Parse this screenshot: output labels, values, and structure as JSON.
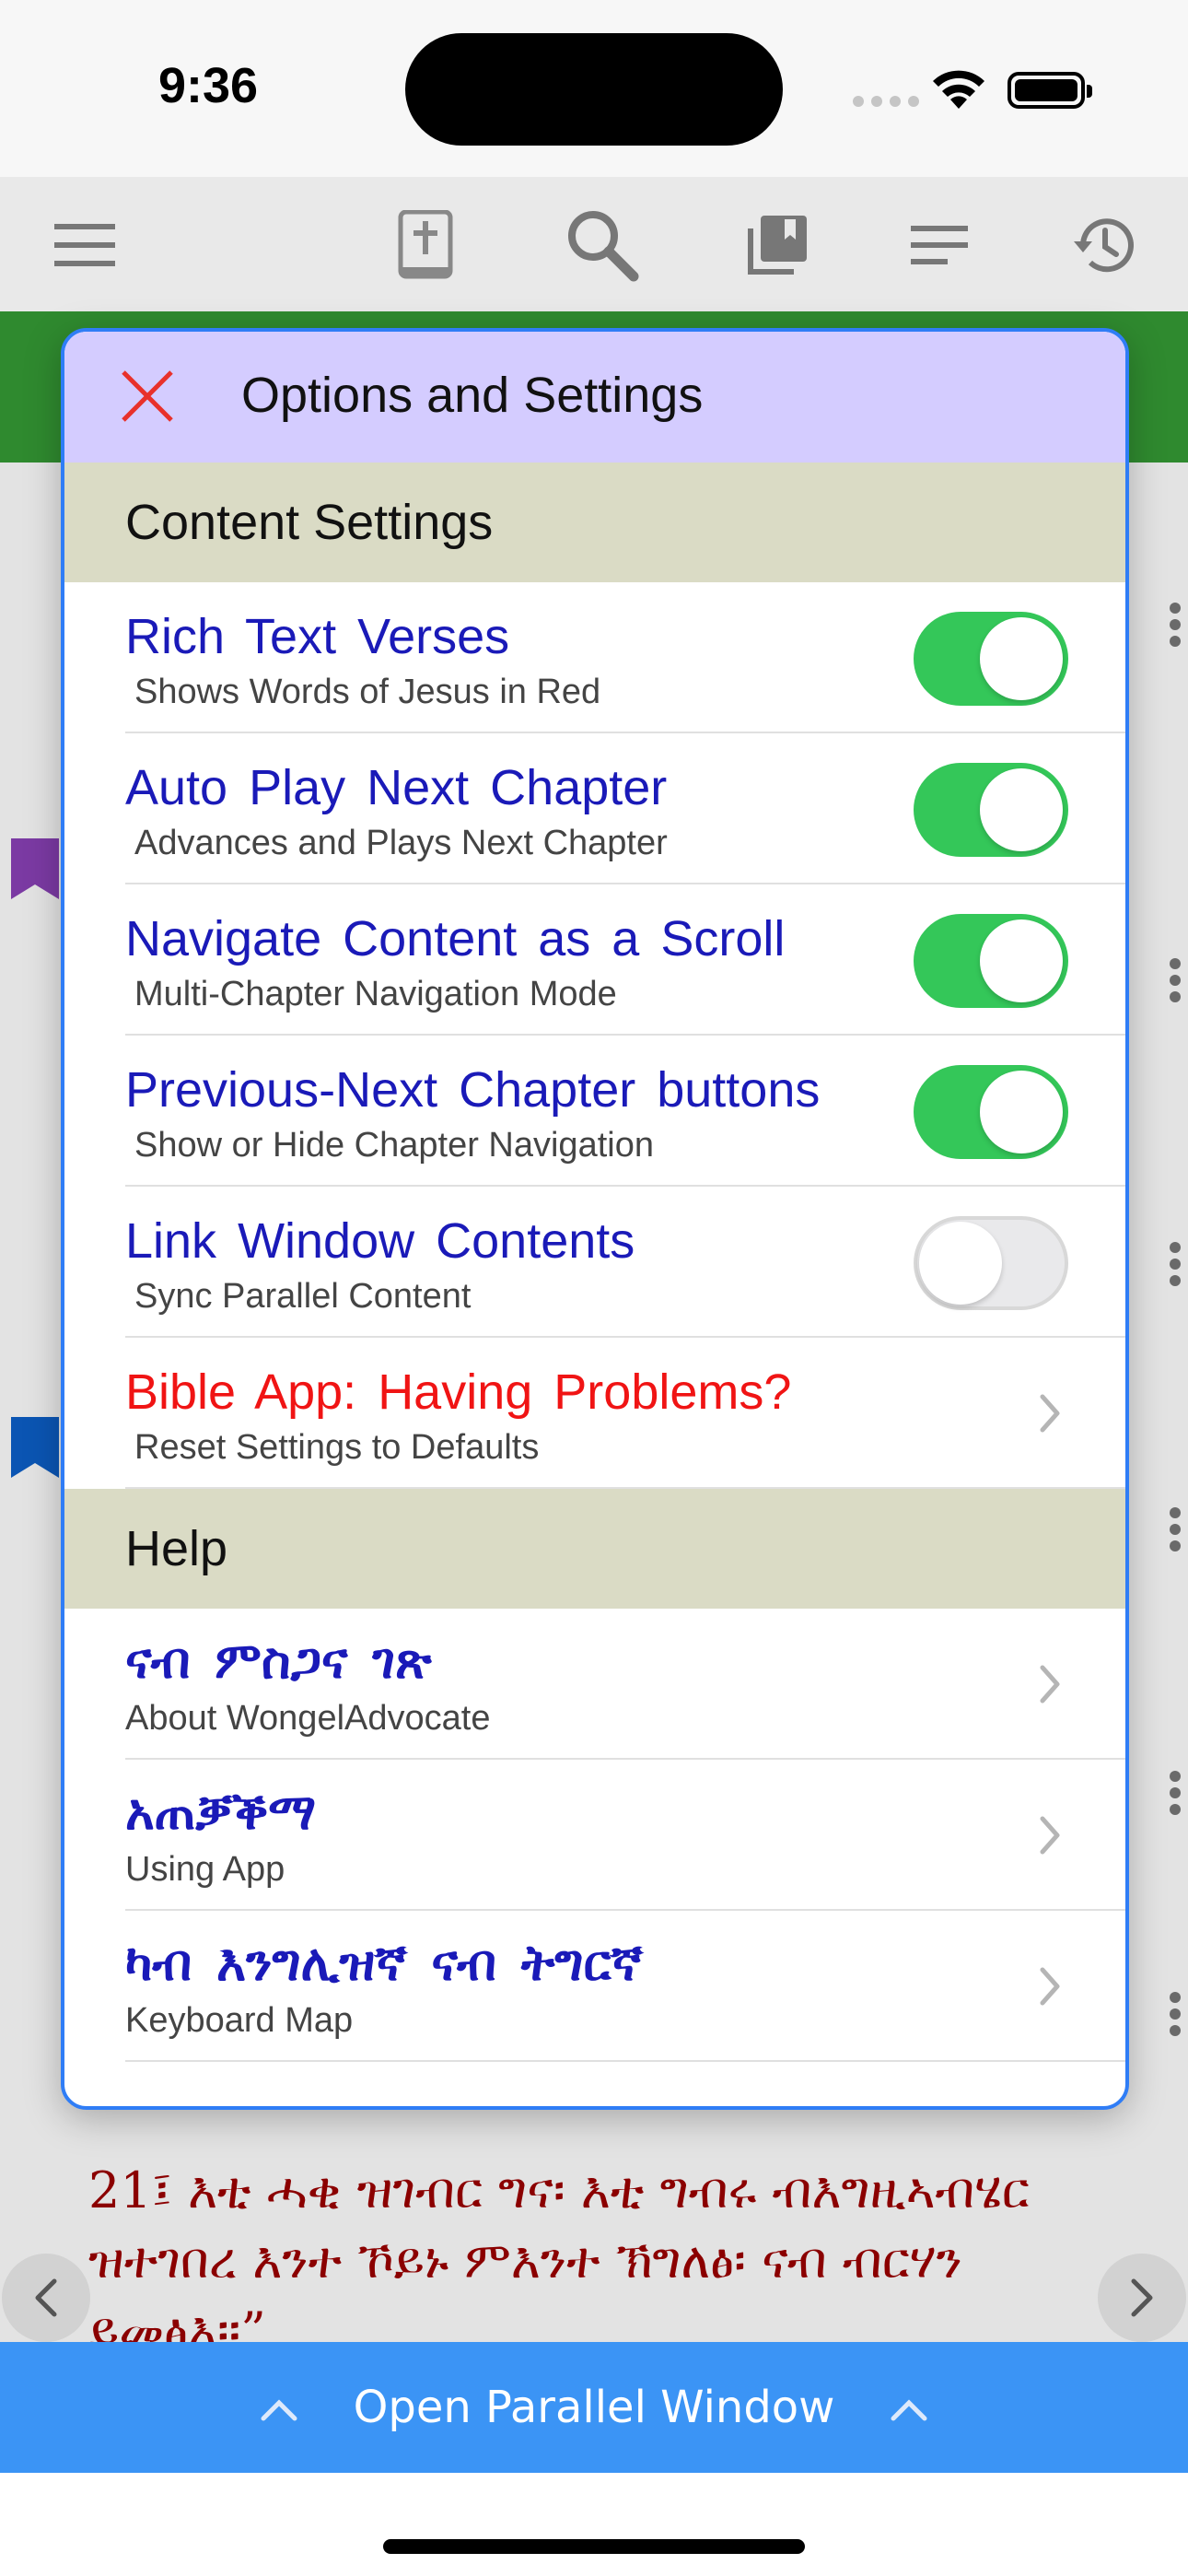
{
  "status_bar": {
    "time": "9:36"
  },
  "toolbar": {
    "icons": [
      "menu-icon",
      "bible-book-icon",
      "search-icon",
      "library-icon",
      "text-lines-icon",
      "history-icon"
    ]
  },
  "dialog": {
    "title": "Options and Settings",
    "content_section": "Content Settings",
    "settings": [
      {
        "title": "Rich Text Verses",
        "subtitle": "Shows Words of Jesus in Red",
        "on": true
      },
      {
        "title": "Auto Play Next Chapter",
        "subtitle": "Advances and Plays Next Chapter",
        "on": true
      },
      {
        "title": "Navigate Content as a Scroll",
        "subtitle": "Multi-Chapter Navigation Mode",
        "on": true
      },
      {
        "title": "Previous-Next Chapter buttons",
        "subtitle": "Show or Hide Chapter Navigation",
        "on": true
      },
      {
        "title": "Link Window Contents",
        "subtitle": "Sync Parallel Content",
        "on": false
      }
    ],
    "problems": {
      "title": "Bible App: Having Problems?",
      "subtitle": "Reset Settings to Defaults"
    },
    "help_section": "Help",
    "help_items": [
      {
        "title": "ናብ ምስጋና ገጽ",
        "subtitle": "About WongelAdvocate"
      },
      {
        "title": "አጠቓቕማ",
        "subtitle": "Using App"
      },
      {
        "title": "ካብ እንግሊዝኛ ናብ ትግርኛ",
        "subtitle": "Keyboard Map"
      }
    ]
  },
  "verse": {
    "text": "21፤ እቲ ሓቂ ዝገብር ግና፡ እቲ ግብሩ ብእግዚኣብሄር ዝተገበረ እንተ ኾይኑ ምእንተ ኽግለፅ፡ ናብ ብርሃን ይመፅእ።”"
  },
  "parallel_bar": {
    "label": "Open Parallel Window"
  },
  "colors": {
    "accent_blue": "#3b94f5",
    "toggle_on": "#34c759",
    "dialog_header": "#d4ccff",
    "section_bg": "#dadbc5",
    "setting_title": "#1a1ab8",
    "warning_title": "#f01414",
    "verse_text": "#8b0000",
    "green_band": "#2f8a2f"
  }
}
